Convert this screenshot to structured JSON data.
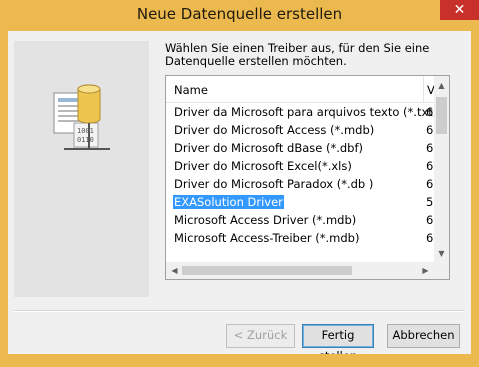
{
  "window": {
    "title": "Neue Datenquelle erstellen",
    "close_glyph": "✕",
    "accent_color": "#ecb94e"
  },
  "wizard": {
    "art_icon": "database-driver-icon",
    "instruction": "Wählen Sie einen Treiber aus, für den Sie eine Datenquelle erstellen möchten."
  },
  "driver_list": {
    "columns": [
      "Name",
      "V"
    ],
    "rows": [
      {
        "name": "Driver da Microsoft para arquivos texto (*.txt; *.csv)",
        "version": "6"
      },
      {
        "name": "Driver do Microsoft Access (*.mdb)",
        "version": "6"
      },
      {
        "name": "Driver do Microsoft dBase (*.dbf)",
        "version": "6"
      },
      {
        "name": "Driver do Microsoft Excel(*.xls)",
        "version": "6"
      },
      {
        "name": "Driver do Microsoft Paradox (*.db )",
        "version": "6"
      },
      {
        "name": "EXASolution Driver",
        "version": "5"
      },
      {
        "name": "Microsoft Access Driver (*.mdb)",
        "version": "6"
      },
      {
        "name": "Microsoft Access-Treiber (*.mdb)",
        "version": "6"
      }
    ],
    "selected_row": "EXASolution Driver"
  },
  "buttons": {
    "back": "< Zurück",
    "finish": "Fertig stellen",
    "cancel": "Abbrechen"
  }
}
